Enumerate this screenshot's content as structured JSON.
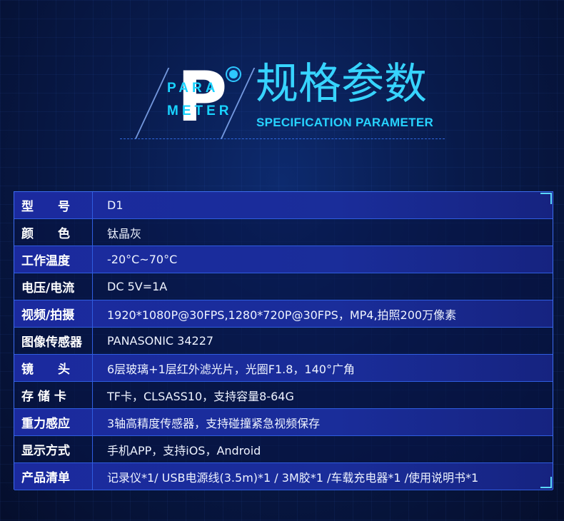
{
  "header": {
    "logo_letter": "P",
    "logo_word_1": "PARA",
    "logo_word_2": "METER",
    "title_cn": "规格参数",
    "title_en": "SPECIFICATION PARAMETER"
  },
  "specs": [
    {
      "label": "型　　号",
      "value": "D1"
    },
    {
      "label": "颜　　色",
      "value": "钛晶灰"
    },
    {
      "label": "工作温度",
      "value": "-20°C~70°C"
    },
    {
      "label": "电压/电流",
      "value": "DC 5V=1A"
    },
    {
      "label": "视频/拍摄",
      "value": "1920*1080P@30FPS,1280*720P@30FPS，MP4,拍照200万像素"
    },
    {
      "label": "图像传感器",
      "value": "PANASONIC 34227"
    },
    {
      "label": "镜　　头",
      "value": "6层玻璃+1层红外滤光片，光圈F1.8，140°广角"
    },
    {
      "label": "存 储 卡",
      "value": "TF卡，CLSASS10，支持容量8-64G"
    },
    {
      "label": "重力感应",
      "value": "3轴高精度传感器，支持碰撞紧急视频保存"
    },
    {
      "label": "显示方式",
      "value": "手机APP，支持iOS，Android"
    },
    {
      "label": "产品清单",
      "value": "记录仪*1/  USB电源线(3.5m)*1 / 3M胶*1  /车载充电器*1  /使用说明书*1"
    }
  ],
  "colors": {
    "accent_cyan": "#27d3ff",
    "row_blue": "#1b2a9e",
    "background": "#081a4a"
  }
}
